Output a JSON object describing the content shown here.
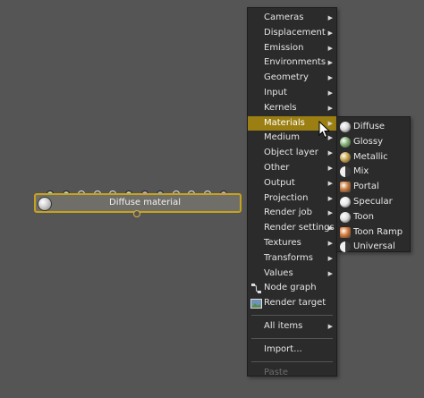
{
  "node": {
    "title": "Diffuse material",
    "pin_colors": [
      "#a8d5b8",
      "#a8d5b8",
      "#555556",
      "#555556",
      "#555556",
      "#a8d5b8",
      "#c9a0d9",
      "#8fb0d8",
      "#555556",
      "#555556",
      "#555556",
      "#c9a0d9"
    ]
  },
  "menu": {
    "items": [
      {
        "label": "Cameras",
        "submenu": true
      },
      {
        "label": "Displacement",
        "submenu": true
      },
      {
        "label": "Emission",
        "submenu": true
      },
      {
        "label": "Environments",
        "submenu": true
      },
      {
        "label": "Geometry",
        "submenu": true
      },
      {
        "label": "Input",
        "submenu": true
      },
      {
        "label": "Kernels",
        "submenu": true
      },
      {
        "label": "Materials",
        "submenu": true,
        "active": true
      },
      {
        "label": "Medium",
        "submenu": true
      },
      {
        "label": "Object layer",
        "submenu": true
      },
      {
        "label": "Other",
        "submenu": true
      },
      {
        "label": "Output",
        "submenu": true
      },
      {
        "label": "Projection",
        "submenu": true
      },
      {
        "label": "Render job",
        "submenu": true
      },
      {
        "label": "Render settings",
        "submenu": true
      },
      {
        "label": "Textures",
        "submenu": true
      },
      {
        "label": "Transforms",
        "submenu": true
      },
      {
        "label": "Values",
        "submenu": true
      },
      {
        "label": "Node graph",
        "icon": "node-graph-icon"
      },
      {
        "label": "Render target",
        "icon": "render-target-icon"
      }
    ],
    "all_items": "All items",
    "import": "Import...",
    "paste": "Paste",
    "submenu_arrow": "▶"
  },
  "materials_submenu": [
    {
      "label": "Diffuse",
      "icon": "diffuse-sphere-icon",
      "color": "#d8d8d8"
    },
    {
      "label": "Glossy",
      "icon": "glossy-sphere-icon",
      "color": "#7fae70"
    },
    {
      "label": "Metallic",
      "icon": "metallic-sphere-icon",
      "color": "#c9a24a"
    },
    {
      "label": "Mix",
      "icon": "mix-icon",
      "color": "#9a9a9a"
    },
    {
      "label": "Portal",
      "icon": "portal-icon",
      "color": "#c97a3c"
    },
    {
      "label": "Specular",
      "icon": "specular-sphere-icon",
      "color": "#e6e6e6"
    },
    {
      "label": "Toon",
      "icon": "toon-sphere-icon",
      "color": "#dcdcdc"
    },
    {
      "label": "Toon Ramp",
      "icon": "toon-ramp-icon",
      "color": "#d87a3a"
    },
    {
      "label": "Universal",
      "icon": "universal-icon",
      "color": "#bdbdbd"
    }
  ]
}
